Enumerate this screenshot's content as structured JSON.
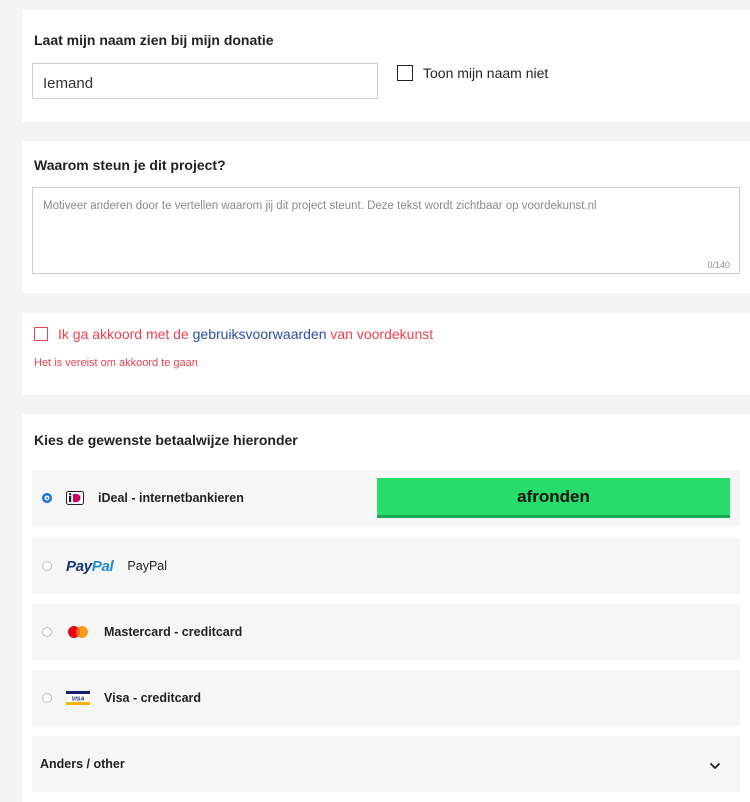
{
  "name_section": {
    "title": "Laat mijn naam zien bij mijn donatie",
    "name_value": "Iemand",
    "hide_label": "Toon mijn naam niet"
  },
  "motivation_section": {
    "title": "Waarom steun je dit project?",
    "placeholder": "Motiveer anderen door te vertellen waarom jij dit project steunt. Deze tekst wordt zichtbaar op voordekunst.nl",
    "counter": "0/140"
  },
  "terms_section": {
    "prefix": "Ik ga akkoord met de",
    "link": "gebruiksvoorwaarden",
    "suffix": "van voordekunst",
    "error": "Het is vereist om akkoord te gaan"
  },
  "payment_section": {
    "title": "Kies de gewenste betaalwijze hieronder",
    "methods": [
      {
        "label": "iDeal - internetbankieren",
        "icon": "ideal-icon",
        "selected": true
      },
      {
        "label": "PayPal",
        "icon": "paypal-logo",
        "selected": false
      },
      {
        "label": "Mastercard - creditcard",
        "icon": "mastercard-icon",
        "selected": false
      },
      {
        "label": "Visa - creditcard",
        "icon": "visa-icon",
        "selected": false
      }
    ],
    "finish_label": "afronden",
    "other_label": "Anders / other",
    "paypal_logo": {
      "part1": "Pay",
      "part2": "Pal"
    },
    "visa_logo_text": "VISA"
  },
  "colors": {
    "accent_green": "#27dc6a",
    "error_red": "#e84352",
    "link_blue": "#2a4fa8",
    "radio_blue": "#1e6fe6"
  }
}
